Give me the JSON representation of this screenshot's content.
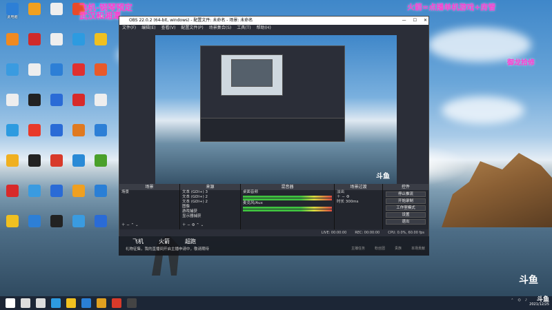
{
  "overlay": {
    "top_left_line1": "飞机-钢琴预定",
    "top_left_line2": "武汉和湘潭",
    "top_right": "火箭=点播单机游戏+房管",
    "right_mid": "御龙拾修"
  },
  "desktop_icons": [
    {
      "label": "此电脑",
      "color": "#2d7fd6"
    },
    {
      "label": "",
      "color": "#f0a020"
    },
    {
      "label": "",
      "color": "#eeeeee"
    },
    {
      "label": "",
      "color": "#e84a2a"
    },
    {
      "label": "网络",
      "color": "#2d9be0"
    },
    {
      "label": "",
      "color": "#f08a20"
    },
    {
      "label": "",
      "color": "#d02a2a"
    },
    {
      "label": "",
      "color": "#eeeeee"
    },
    {
      "label": "",
      "color": "#2d9be0"
    },
    {
      "label": "",
      "color": "#f0c020"
    },
    {
      "label": "",
      "color": "#3a9be0"
    },
    {
      "label": "",
      "color": "#eeeeee"
    },
    {
      "label": "",
      "color": "#2d7fd6"
    },
    {
      "label": "",
      "color": "#e03030"
    },
    {
      "label": "",
      "color": "#e85a2a"
    },
    {
      "label": "",
      "color": "#eeeeee"
    },
    {
      "label": "",
      "color": "#222222"
    },
    {
      "label": "",
      "color": "#2a6bd6"
    },
    {
      "label": "",
      "color": "#d82a2a"
    },
    {
      "label": "",
      "color": "#eeeeee"
    },
    {
      "label": "",
      "color": "#2d9be0"
    },
    {
      "label": "",
      "color": "#e83a2a"
    },
    {
      "label": "",
      "color": "#2a6bd6"
    },
    {
      "label": "",
      "color": "#e07a20"
    },
    {
      "label": "",
      "color": "#2d7fd6"
    },
    {
      "label": "",
      "color": "#f0b020"
    },
    {
      "label": "",
      "color": "#222222"
    },
    {
      "label": "",
      "color": "#d83a2a"
    },
    {
      "label": "",
      "color": "#2a8ad6"
    },
    {
      "label": "",
      "color": "#4aa02a"
    },
    {
      "label": "",
      "color": "#d82a2a"
    },
    {
      "label": "",
      "color": "#3a9be0"
    },
    {
      "label": "",
      "color": "#2a6bd6"
    },
    {
      "label": "",
      "color": "#f0a020"
    },
    {
      "label": "",
      "color": "#2a7fd6"
    },
    {
      "label": "",
      "color": "#f0c020"
    },
    {
      "label": "",
      "color": "#2d7fd6"
    },
    {
      "label": "",
      "color": "#222222"
    },
    {
      "label": "",
      "color": "#3a9be0"
    },
    {
      "label": "",
      "color": "#2a6bd6"
    }
  ],
  "obs": {
    "title": "OBS 22.0.2 (64-bit, windows) - 配置文件: 未命名 - 场景: 未命名",
    "menu": [
      "文件(F)",
      "编辑(E)",
      "查看(V)",
      "配置文件(P)",
      "场景集合(S)",
      "工具(T)",
      "帮助(H)"
    ],
    "docks": {
      "scenes": {
        "title": "场景",
        "items": [
          "场景"
        ]
      },
      "sources": {
        "title": "来源",
        "items": [
          "文本 (GDI+) 3",
          "文本 (GDI+) 2",
          "文本 (GDI+) 2",
          "图像",
          "游戏捕获",
          "显示器捕获"
        ]
      },
      "mixer": {
        "title": "混音器",
        "items": [
          "桌面音频",
          "麦克风/Aux"
        ]
      },
      "transitions": {
        "title": "场景过渡",
        "type": "淡出",
        "duration_label": "时长",
        "duration": "300ms"
      },
      "controls": {
        "title": "控件",
        "buttons": [
          "停止推流",
          "开始录制",
          "工作室模式",
          "设置",
          "退出"
        ]
      }
    },
    "status": [
      "LIVE: 00:00:00",
      "REC: 00:00:00",
      "CPU: 0.0%, 60.00 fps"
    ]
  },
  "notify": {
    "tabs": [
      "飞机",
      "火箭",
      "超跑"
    ],
    "message": "礼物征集，我的直播间开启主播申请中，敬请期待",
    "right": [
      "主播任务",
      "粉丝团",
      "贵族",
      "本场贡献"
    ]
  },
  "taskbar": {
    "icons": [
      {
        "name": "windows-start-icon",
        "color": "#ffffff"
      },
      {
        "name": "search-icon",
        "color": "#dddddd"
      },
      {
        "name": "task-view-icon",
        "color": "#dddddd"
      },
      {
        "name": "edge-icon",
        "color": "#2d9be0"
      },
      {
        "name": "explorer-icon",
        "color": "#f0c020"
      },
      {
        "name": "shield-icon",
        "color": "#2a7fd6"
      },
      {
        "name": "chrome-icon",
        "color": "#e0a020"
      },
      {
        "name": "wps-icon",
        "color": "#d83a2a"
      },
      {
        "name": "obs-icon",
        "color": "#444444"
      }
    ],
    "date": "2021/12/25",
    "brand": "斗鱼"
  },
  "watermark": "斗鱼"
}
